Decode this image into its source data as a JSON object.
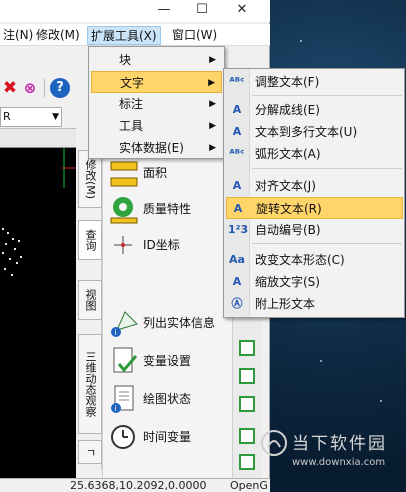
{
  "menubar": {
    "items": [
      {
        "label": "注(N)"
      },
      {
        "label": "修改(M)"
      },
      {
        "label": "扩展工具(X)"
      },
      {
        "label": "窗口(W)"
      }
    ]
  },
  "window_controls": {
    "minimize": "—",
    "maximize": "☐",
    "close": "✕"
  },
  "toolbar": {
    "x_icon": "✖",
    "target_icon": "⊗",
    "help_icon": "?"
  },
  "combo": {
    "value": "R",
    "arrow": "▼"
  },
  "tabs": [
    {
      "label": "修改(M)"
    },
    {
      "label": "查询"
    },
    {
      "label": "视图"
    },
    {
      "label": "三维动态观察"
    },
    {
      "label": "ㄱ"
    }
  ],
  "panel": {
    "items": [
      {
        "label": "面积",
        "icon": "ruler-icon"
      },
      {
        "label": "质量特性",
        "icon": "ring-icon"
      },
      {
        "label": "ID坐标",
        "icon": "crosshair-icon"
      },
      {
        "label": "列出实体信息",
        "icon": "info-shape-icon"
      },
      {
        "label": "变量设置",
        "icon": "doc-check-icon"
      },
      {
        "label": "绘图状态",
        "icon": "list-info-icon"
      },
      {
        "label": "时间变量",
        "icon": "clock-icon"
      }
    ]
  },
  "status": {
    "coords": "25.6368,10.2092,0.0000",
    "opengl": "OpenG"
  },
  "dropdown": {
    "items": [
      {
        "label": "块",
        "arrow": "▶"
      },
      {
        "label": "文字",
        "arrow": "▶"
      },
      {
        "label": "标注",
        "arrow": "▶"
      },
      {
        "label": "工具",
        "arrow": "▶"
      },
      {
        "label": "实体数据(E)",
        "arrow": "▶"
      }
    ]
  },
  "submenu": {
    "items": [
      {
        "label": "调整文本(F)",
        "icon": "ᴬᴮᶜ"
      },
      {
        "label": "分解成线(E)",
        "icon": "A"
      },
      {
        "label": "文本到多行文本(U)",
        "icon": "A"
      },
      {
        "label": "弧形文本(A)",
        "icon": "ᴬᴮᶜ"
      },
      {
        "label": "对齐文本(J)",
        "icon": "A"
      },
      {
        "label": "旋转文本(R)",
        "icon": "A"
      },
      {
        "label": "自动编号(B)",
        "icon": "1²3"
      },
      {
        "label": "改变文本形态(C)",
        "icon": "Aa"
      },
      {
        "label": "缩放文字(S)",
        "icon": "A"
      },
      {
        "label": "附上形文本",
        "icon": "Ⓐ"
      }
    ]
  },
  "watermark": {
    "title": "当下软件园",
    "url": "www.downxia.com"
  }
}
